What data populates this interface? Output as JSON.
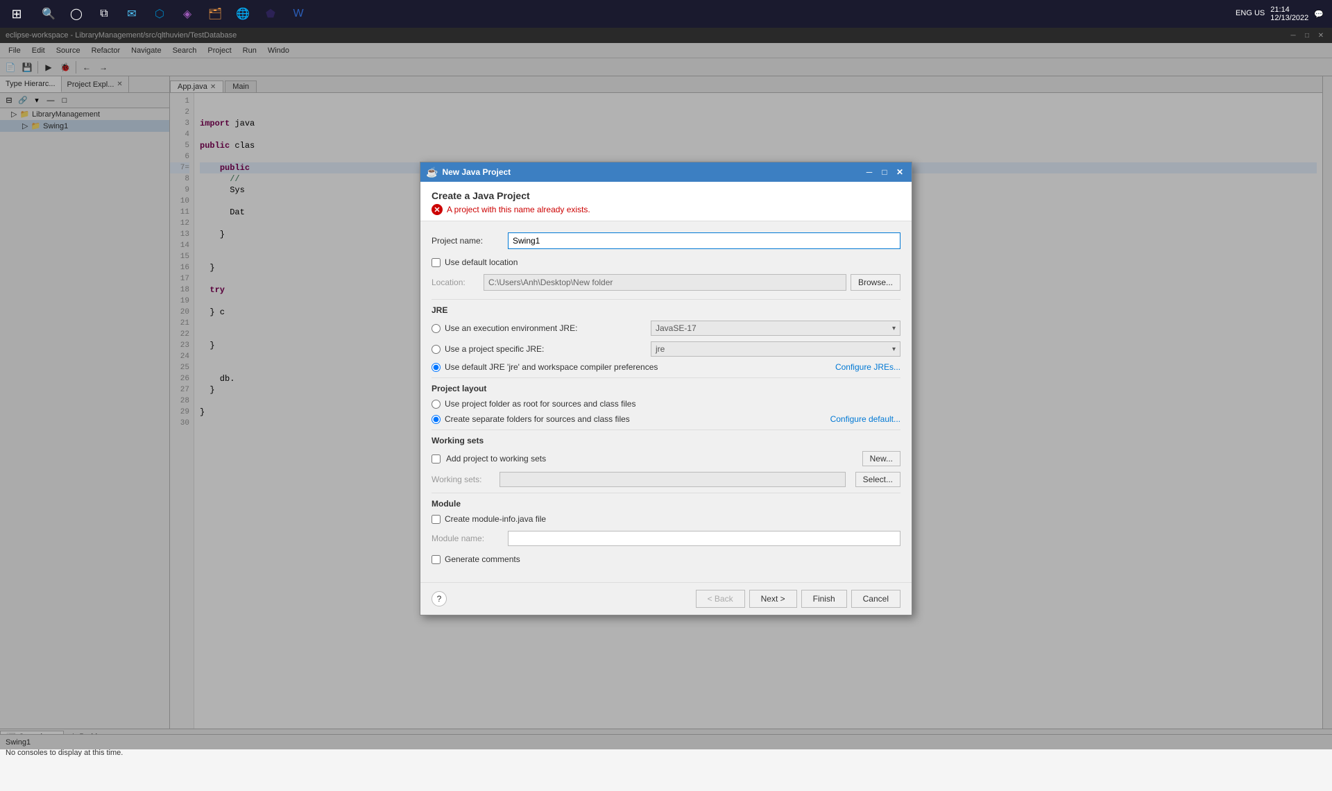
{
  "taskbar": {
    "start_icon": "⊞",
    "time": "21:14",
    "date": "12/13/2022",
    "lang": "ENG\nUS"
  },
  "eclipse": {
    "title": "eclipse-workspace - LibraryManagement/src/qlthuvien/TestDatabase",
    "menu": [
      "File",
      "Edit",
      "Source",
      "Refactor",
      "Navigate",
      "Search",
      "Project",
      "Run",
      "Windo"
    ],
    "tabs": {
      "left": [
        "Type Hierarc...",
        "Project Expl..."
      ],
      "editor": [
        "App.java",
        "Main"
      ]
    },
    "tree": {
      "items": [
        {
          "label": "LibraryManagement",
          "icon": "📁",
          "indent": 0
        },
        {
          "label": "Swing1",
          "icon": "📁",
          "indent": 1
        }
      ]
    },
    "code_lines": [
      {
        "num": 1,
        "text": ""
      },
      {
        "num": 2,
        "text": ""
      },
      {
        "num": 3,
        "text": "  import java"
      },
      {
        "num": 4,
        "text": ""
      },
      {
        "num": 5,
        "text": "  public clas"
      },
      {
        "num": 6,
        "text": ""
      },
      {
        "num": 7,
        "text": "    public"
      },
      {
        "num": 8,
        "text": "      //"
      },
      {
        "num": 9,
        "text": "      Sys"
      },
      {
        "num": 10,
        "text": ""
      },
      {
        "num": 11,
        "text": "      Dat"
      },
      {
        "num": 12,
        "text": "      "
      },
      {
        "num": 13,
        "text": "    }"
      },
      {
        "num": 14,
        "text": ""
      },
      {
        "num": 15,
        "text": ""
      },
      {
        "num": 16,
        "text": "  }"
      },
      {
        "num": 17,
        "text": ""
      },
      {
        "num": 18,
        "text": "  try"
      },
      {
        "num": 19,
        "text": ""
      },
      {
        "num": 20,
        "text": "  } c"
      },
      {
        "num": 21,
        "text": ""
      },
      {
        "num": 22,
        "text": ""
      },
      {
        "num": 23,
        "text": "  }"
      },
      {
        "num": 24,
        "text": ""
      },
      {
        "num": 25,
        "text": ""
      },
      {
        "num": 26,
        "text": "    db."
      },
      {
        "num": 27,
        "text": "  }"
      },
      {
        "num": 28,
        "text": ""
      },
      {
        "num": 29,
        "text": "}"
      },
      {
        "num": 30,
        "text": ""
      }
    ],
    "bottom_tabs": [
      "Console",
      "Problems"
    ],
    "bottom_content": "No consoles to display at this time.",
    "statusbar": "Swing1"
  },
  "dialog": {
    "title": "New Java Project",
    "header_title": "Create a Java Project",
    "error_message": "A project with this name already exists.",
    "project_name_label": "Project name:",
    "project_name_value": "Swing1",
    "use_default_location_label": "Use default location",
    "use_default_location_checked": false,
    "location_label": "Location:",
    "location_value": "C:\\Users\\Anh\\Desktop\\New folder",
    "browse_label": "Browse...",
    "jre_section": "JRE",
    "jre_options": [
      {
        "label": "Use an execution environment JRE:",
        "selected": false,
        "dropdown": "JavaSE-17"
      },
      {
        "label": "Use a project specific JRE:",
        "selected": false,
        "dropdown": "jre"
      },
      {
        "label": "Use default JRE 'jre' and workspace compiler preferences",
        "selected": true
      }
    ],
    "configure_jres_label": "Configure JREs...",
    "layout_section": "Project layout",
    "layout_options": [
      {
        "label": "Use project folder as root for sources and class files",
        "selected": false
      },
      {
        "label": "Create separate folders for sources and class files",
        "selected": true
      }
    ],
    "configure_default_label": "Configure default...",
    "working_sets_section": "Working sets",
    "add_to_working_sets_label": "Add project to working sets",
    "add_to_working_sets_checked": false,
    "working_sets_label": "Working sets:",
    "new_label": "New...",
    "select_label": "Select...",
    "module_section": "Module",
    "create_module_info_label": "Create module-info.java file",
    "create_module_info_checked": false,
    "module_name_label": "Module name:",
    "module_name_value": "",
    "generate_comments_label": "Generate comments",
    "generate_comments_checked": false,
    "footer": {
      "back_label": "< Back",
      "next_label": "Next >",
      "finish_label": "Finish",
      "cancel_label": "Cancel"
    }
  }
}
